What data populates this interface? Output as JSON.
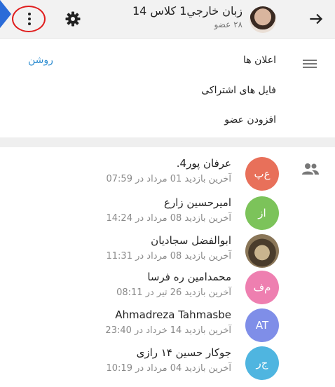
{
  "header": {
    "title": "زبان خارجي1 کلاس 14",
    "subtitle": "۲۸ عضو",
    "back_icon": "arrow-right-icon",
    "settings_icon": "gear-icon",
    "menu_icon": "more-vert-icon"
  },
  "settings": {
    "notifications_label": "اعلان ها",
    "notifications_value": "روشن",
    "shared_files_label": "فایل های اشتراکی",
    "add_member_label": "افزودن عضو"
  },
  "members": [
    {
      "name": "عرفان پور4.",
      "last_seen": "آخرین بازدید 01 مرداد در 07:59",
      "initials": "ع‌پ",
      "color": "#e8705a"
    },
    {
      "name": "امیرحسین زارع",
      "last_seen": "آخرین بازدید 08 مرداد در 14:24",
      "initials": "از",
      "color": "#7cc35a"
    },
    {
      "name": "ابوالفضل سجادیان",
      "last_seen": "آخرین بازدید 08 مرداد در 11:31",
      "initials": "",
      "color": "#6b5a48"
    },
    {
      "name": "محمدامین ره فرسا",
      "last_seen": "آخرین بازدید 26 تیر در 08:11",
      "initials": "م‌ف",
      "color": "#ee7fb0"
    },
    {
      "name": "Ahmadreza Tahmasbe",
      "last_seen": "آخرین بازدید 14 خرداد در 23:40",
      "initials": "AT",
      "color": "#7f8ee8"
    },
    {
      "name": "جوکار حسین ۱۴ رازی",
      "last_seen": "آخرین بازدید 04 مرداد در 10:19",
      "initials": "ج‌ر",
      "color": "#4fb5e0"
    }
  ],
  "colors": {
    "accent_status": "#2a8bd0",
    "highlight_circle": "#e01d1d",
    "edge_marker": "#2a6bd8"
  }
}
